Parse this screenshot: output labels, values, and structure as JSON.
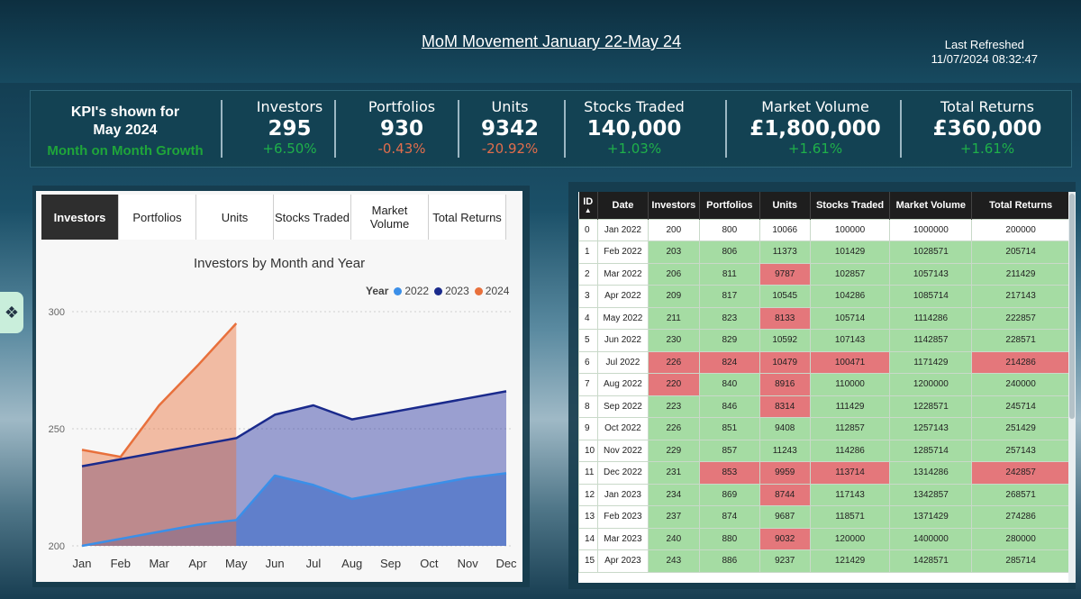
{
  "header": {
    "title": "MoM Movement January 22-May 24",
    "refresh_label": "Last Refreshed",
    "refresh_time": "11/07/2024 08:32:47"
  },
  "kpi_intro": {
    "line1": "KPI's shown for",
    "line2": "May 2024",
    "line3": "Month on Month  Growth"
  },
  "kpis": [
    {
      "label": "Investors",
      "value": "295",
      "change": "+6.50%",
      "trend": "pos"
    },
    {
      "label": "Portfolios",
      "value": "930",
      "change": "-0.43%",
      "trend": "neg"
    },
    {
      "label": "Units",
      "value": "9342",
      "change": "-20.92%",
      "trend": "neg"
    },
    {
      "label": "Stocks Traded",
      "value": "140,000",
      "change": "+1.03%",
      "trend": "pos"
    },
    {
      "label": "Market Volume",
      "value": "£1,800,000",
      "change": "+1.61%",
      "trend": "pos"
    },
    {
      "label": "Total Returns",
      "value": "£360,000",
      "change": "+1.61%",
      "trend": "pos"
    }
  ],
  "tabs": [
    {
      "label": "Investors",
      "active": true
    },
    {
      "label": "Portfolios",
      "active": false
    },
    {
      "label": "Units",
      "active": false
    },
    {
      "label": "Stocks Traded",
      "active": false
    },
    {
      "label": "Market Volume",
      "active": false
    },
    {
      "label": "Total Returns",
      "active": false
    }
  ],
  "legend": {
    "title": "Year"
  },
  "chart_data": {
    "type": "area",
    "title": "Investors by Month and Year",
    "categories": [
      "Jan",
      "Feb",
      "Mar",
      "Apr",
      "May",
      "Jun",
      "Jul",
      "Aug",
      "Sep",
      "Oct",
      "Nov",
      "Dec"
    ],
    "y_ticks": [
      "200",
      "250",
      "300"
    ],
    "ylim": [
      200,
      300
    ],
    "legend_position": "top-right",
    "series": [
      {
        "name": "2022",
        "color": "#3b8fe8",
        "values": [
          200,
          203,
          206,
          209,
          211,
          230,
          226,
          220,
          223,
          226,
          229,
          231
        ]
      },
      {
        "name": "2023",
        "color": "#1a2a8c",
        "values": [
          234,
          237,
          240,
          243,
          246,
          256,
          260,
          254,
          257,
          260,
          263,
          266
        ]
      },
      {
        "name": "2024",
        "color": "#e8703c",
        "values": [
          241,
          238,
          260,
          277,
          295
        ]
      }
    ]
  },
  "table": {
    "sort_icon": "sort-ascending-icon",
    "columns": [
      "ID",
      "Date",
      "Investors",
      "Portfolios",
      "Units",
      "Stocks Traded",
      "Market Volume",
      "Total Returns"
    ],
    "rows": [
      {
        "cells": [
          "0",
          "Jan 2022",
          "200",
          "800",
          "10066",
          "100000",
          "1000000",
          "200000"
        ],
        "status": [
          "w",
          "w",
          "w",
          "w",
          "w",
          "w"
        ]
      },
      {
        "cells": [
          "1",
          "Feb 2022",
          "203",
          "806",
          "11373",
          "101429",
          "1028571",
          "205714"
        ],
        "status": [
          "g",
          "g",
          "g",
          "g",
          "g",
          "g"
        ]
      },
      {
        "cells": [
          "2",
          "Mar 2022",
          "206",
          "811",
          "9787",
          "102857",
          "1057143",
          "211429"
        ],
        "status": [
          "g",
          "g",
          "r",
          "g",
          "g",
          "g"
        ]
      },
      {
        "cells": [
          "3",
          "Apr 2022",
          "209",
          "817",
          "10545",
          "104286",
          "1085714",
          "217143"
        ],
        "status": [
          "g",
          "g",
          "g",
          "g",
          "g",
          "g"
        ]
      },
      {
        "cells": [
          "4",
          "May 2022",
          "211",
          "823",
          "8133",
          "105714",
          "1114286",
          "222857"
        ],
        "status": [
          "g",
          "g",
          "r",
          "g",
          "g",
          "g"
        ]
      },
      {
        "cells": [
          "5",
          "Jun 2022",
          "230",
          "829",
          "10592",
          "107143",
          "1142857",
          "228571"
        ],
        "status": [
          "g",
          "g",
          "g",
          "g",
          "g",
          "g"
        ]
      },
      {
        "cells": [
          "6",
          "Jul 2022",
          "226",
          "824",
          "10479",
          "100471",
          "1171429",
          "214286"
        ],
        "status": [
          "r",
          "r",
          "r",
          "r",
          "g",
          "r"
        ]
      },
      {
        "cells": [
          "7",
          "Aug 2022",
          "220",
          "840",
          "8916",
          "110000",
          "1200000",
          "240000"
        ],
        "status": [
          "r",
          "g",
          "r",
          "g",
          "g",
          "g"
        ]
      },
      {
        "cells": [
          "8",
          "Sep 2022",
          "223",
          "846",
          "8314",
          "111429",
          "1228571",
          "245714"
        ],
        "status": [
          "g",
          "g",
          "r",
          "g",
          "g",
          "g"
        ]
      },
      {
        "cells": [
          "9",
          "Oct 2022",
          "226",
          "851",
          "9408",
          "112857",
          "1257143",
          "251429"
        ],
        "status": [
          "g",
          "g",
          "g",
          "g",
          "g",
          "g"
        ]
      },
      {
        "cells": [
          "10",
          "Nov 2022",
          "229",
          "857",
          "11243",
          "114286",
          "1285714",
          "257143"
        ],
        "status": [
          "g",
          "g",
          "g",
          "g",
          "g",
          "g"
        ]
      },
      {
        "cells": [
          "11",
          "Dec 2022",
          "231",
          "853",
          "9959",
          "113714",
          "1314286",
          "242857"
        ],
        "status": [
          "g",
          "r",
          "r",
          "r",
          "g",
          "r"
        ]
      },
      {
        "cells": [
          "12",
          "Jan 2023",
          "234",
          "869",
          "8744",
          "117143",
          "1342857",
          "268571"
        ],
        "status": [
          "g",
          "g",
          "r",
          "g",
          "g",
          "g"
        ]
      },
      {
        "cells": [
          "13",
          "Feb 2023",
          "237",
          "874",
          "9687",
          "118571",
          "1371429",
          "274286"
        ],
        "status": [
          "g",
          "g",
          "g",
          "g",
          "g",
          "g"
        ]
      },
      {
        "cells": [
          "14",
          "Mar 2023",
          "240",
          "880",
          "9032",
          "120000",
          "1400000",
          "280000"
        ],
        "status": [
          "g",
          "g",
          "r",
          "g",
          "g",
          "g"
        ]
      },
      {
        "cells": [
          "15",
          "Apr 2023",
          "243",
          "886",
          "9237",
          "121429",
          "1428571",
          "285714"
        ],
        "status": [
          "g",
          "g",
          "g",
          "g",
          "g",
          "g"
        ]
      }
    ]
  }
}
